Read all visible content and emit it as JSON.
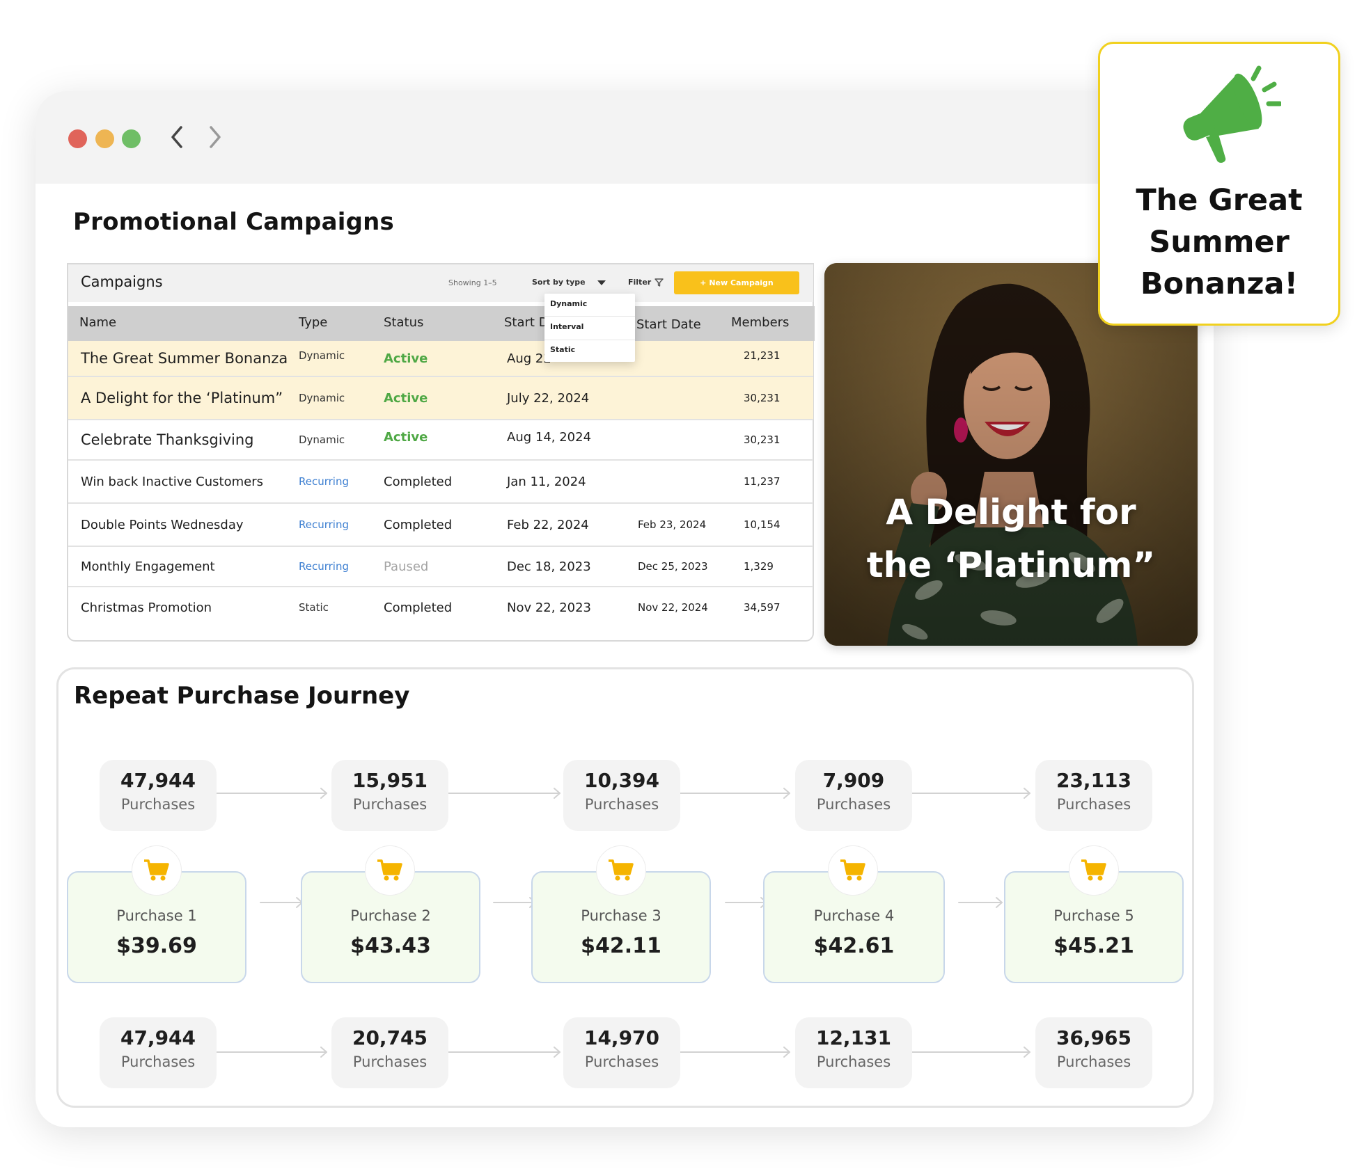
{
  "page": {
    "title": "Promotional Campaigns"
  },
  "campaigns": {
    "title": "Campaigns",
    "showing": "Showing 1–5",
    "sort_label": "Sort by type",
    "filter_label": "Filter",
    "new_button": "+ New Campaign",
    "sort_options": [
      "Dynamic",
      "Interval",
      "Static"
    ],
    "columns": [
      "Name",
      "Type",
      "Status",
      "Start D",
      "Start Date",
      "Members"
    ],
    "rows": [
      {
        "name": "The Great Summer Bonanza",
        "type": "Dynamic",
        "status": "Active",
        "start": "Aug 22",
        "start2": "",
        "members": "21,231"
      },
      {
        "name": "A Delight for the ‘Platinum”",
        "type": "Dynamic",
        "status": "Active",
        "start": "July 22, 2024",
        "start2": "",
        "members": "30,231"
      },
      {
        "name": "Celebrate Thanksgiving",
        "type": "Dynamic",
        "status": "Active",
        "start": "Aug 14, 2024",
        "start2": "",
        "members": "30,231"
      },
      {
        "name": "Win back Inactive Customers",
        "type": "Recurring",
        "status": "Completed",
        "start": "Jan 11, 2024",
        "start2": "",
        "members": "11,237"
      },
      {
        "name": "Double Points Wednesday",
        "type": "Recurring",
        "status": "Completed",
        "start": "Feb 22, 2024",
        "start2": "Feb 23, 2024",
        "members": "10,154"
      },
      {
        "name": "Monthly Engagement",
        "type": "Recurring",
        "status": "Paused",
        "start": "Dec 18, 2023",
        "start2": "Dec 25, 2023",
        "members": "1,329"
      },
      {
        "name": "Christmas Promotion",
        "type": "Static",
        "status": "Completed",
        "start": "Nov 22, 2023",
        "start2": "Nov 22, 2024",
        "members": "34,597"
      }
    ]
  },
  "photo": {
    "caption_line1": "A Delight for",
    "caption_line2": "the ‘Platinum”"
  },
  "journey": {
    "title": "Repeat Purchase Journey",
    "top_stats": [
      {
        "value": "47,944",
        "label": "Purchases"
      },
      {
        "value": "15,951",
        "label": "Purchases"
      },
      {
        "value": "10,394",
        "label": "Purchases"
      },
      {
        "value": "7,909",
        "label": "Purchases"
      },
      {
        "value": "23,113",
        "label": "Purchases"
      }
    ],
    "purchases": [
      {
        "label": "Purchase 1",
        "value": "$39.69"
      },
      {
        "label": "Purchase 2",
        "value": "$43.43"
      },
      {
        "label": "Purchase 3",
        "value": "$42.11"
      },
      {
        "label": "Purchase 4",
        "value": "$42.61"
      },
      {
        "label": "Purchase 5",
        "value": "$45.21"
      }
    ],
    "bottom_stats": [
      {
        "value": "47,944",
        "label": "Purchases"
      },
      {
        "value": "20,745",
        "label": "Purchases"
      },
      {
        "value": "14,970",
        "label": "Purchases"
      },
      {
        "value": "12,131",
        "label": "Purchases"
      },
      {
        "value": "36,965",
        "label": "Purchases"
      }
    ]
  },
  "callout": {
    "line1": "The Great",
    "line2": "Summer",
    "line3": "Bonanza!"
  },
  "icons": {
    "megaphone": "megaphone-icon",
    "cart": "cart-icon",
    "filter": "filter-icon"
  },
  "colors": {
    "accent_yellow": "#f9c11b",
    "active_green": "#4fa845",
    "recurring_blue": "#3d7fd1",
    "megaphone_green": "#4fae45"
  }
}
